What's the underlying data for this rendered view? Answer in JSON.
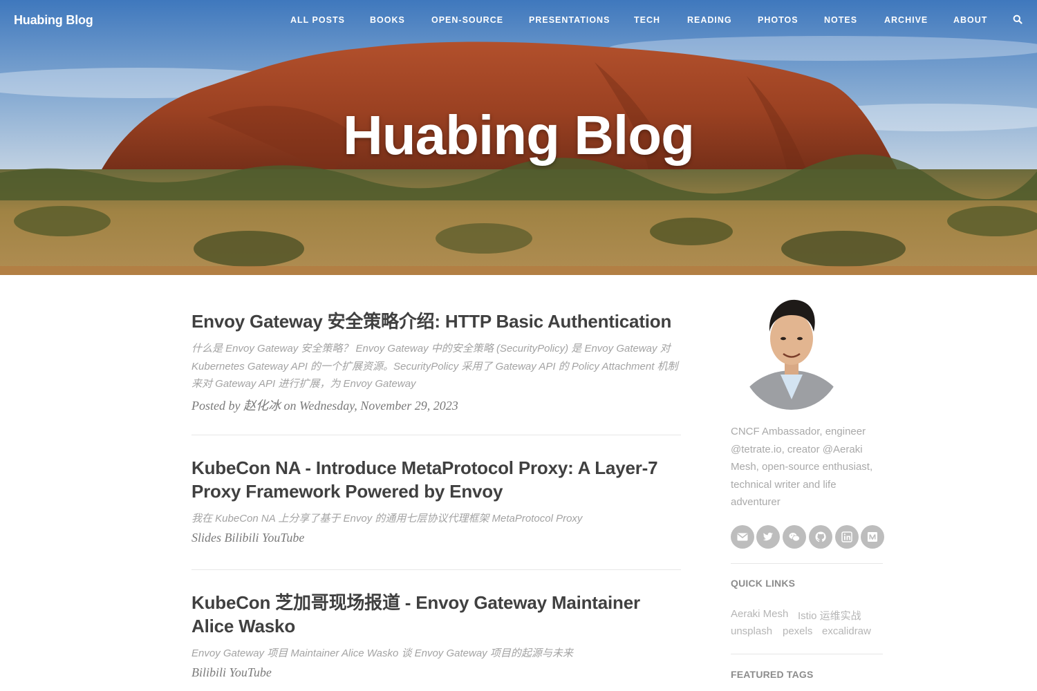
{
  "site": {
    "brand": "Huabing Blog",
    "hero_title": "Huabing Blog"
  },
  "nav": {
    "items": [
      "ALL POSTS",
      "BOOKS",
      "OPEN-SOURCE",
      "PRESENTATIONS",
      "TECH",
      "READING",
      "PHOTOS",
      "NOTES",
      "ARCHIVE",
      "ABOUT"
    ],
    "search_icon": "search-icon"
  },
  "posts": [
    {
      "title": "Envoy Gateway 安全策略介绍: HTTP Basic Authentication",
      "excerpt": [
        "什么是 Envoy Gateway 安全策略？ Envoy Gateway 中的安全策略 (SecurityPolicy) 是 Envoy Gateway 对",
        "Kubernetes Gateway API 的一个扩展资源。SecurityPolicy 采用了 Gateway API 的 Policy Attachment 机制",
        "来对 Gateway API 进行扩展，为 Envoy Gateway"
      ],
      "meta_prefix": "Posted by",
      "author": "赵化冰",
      "meta_middle": "on",
      "date": "Wednesday, November 29, 2023"
    },
    {
      "title_lines": [
        "KubeCon NA - Introduce MetaProtocol Proxy: A Layer-7",
        "Proxy Framework Powered by Envoy"
      ],
      "excerpt": "我在 KubeCon NA 上分享了基于 Envoy 的通用七层协议代理框架 MetaProtocol Proxy",
      "links": [
        "Slides",
        "Bilibili",
        "YouTube"
      ]
    },
    {
      "title_lines": [
        "KubeCon 芝加哥现场报道 - Envoy Gateway Maintainer",
        "Alice Wasko"
      ],
      "excerpt": "Envoy Gateway 项目 Maintainer Alice Wasko 谈 Envoy Gateway 项目的起源与未来",
      "links": [
        "Bilibili",
        "YouTube"
      ]
    }
  ],
  "sidebar": {
    "bio_lines": [
      "CNCF Ambassador, engineer",
      "@tetrate.io, creator @Aeraki",
      "Mesh, open-source enthusiast,",
      "technical writer and life",
      "adventurer"
    ],
    "social_icons": [
      "envelope-icon",
      "twitter-icon",
      "wechat-icon",
      "github-icon",
      "linkedin-icon",
      "medium-icon"
    ],
    "quick_links_heading": "QUICK LINKS",
    "quick_links": [
      "Aeraki Mesh",
      "Istio 运维实战",
      "unsplash",
      "pexels",
      "excalidraw"
    ],
    "featured_tags_heading": "FEATURED TAGS"
  },
  "colors": {
    "text": "#404040",
    "muted": "#a3a3a3",
    "social_bg": "#bdbdbd"
  }
}
